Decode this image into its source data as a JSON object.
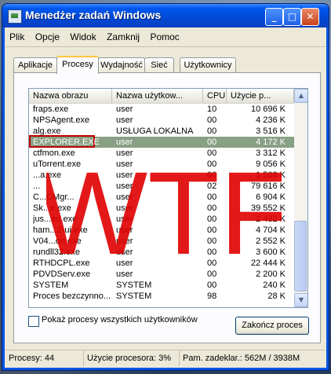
{
  "window": {
    "title": "Menedżer zadań Windows",
    "controls": {
      "minimize": "_",
      "maximize": "□",
      "close": "✕"
    }
  },
  "menu": [
    "Plik",
    "Opcje",
    "Widok",
    "Zamknij",
    "Pomoc"
  ],
  "tabs": [
    {
      "label": "Aplikacje",
      "active": false
    },
    {
      "label": "Procesy",
      "active": true
    },
    {
      "label": "Wydajność",
      "active": false
    },
    {
      "label": "Sieć",
      "active": false
    },
    {
      "label": "Użytkownicy",
      "active": false
    }
  ],
  "processes": {
    "columns": [
      "Nazwa obrazu",
      "Nazwa użytkow...",
      "CPU",
      "Użycie p..."
    ],
    "rows": [
      {
        "name": "fraps.exe",
        "user": "user",
        "cpu": "10",
        "mem": "10 696 K"
      },
      {
        "name": "NPSAgent.exe",
        "user": "user",
        "cpu": "00",
        "mem": "4 236 K"
      },
      {
        "name": "alg.exe",
        "user": "USŁUGA LOKALNA",
        "cpu": "00",
        "mem": "3 516 K"
      },
      {
        "name": "EXPLORER.EXE",
        "user": "user",
        "cpu": "00",
        "mem": "4 172 K",
        "selected": true
      },
      {
        "name": "ctfmon.exe",
        "user": "user",
        "cpu": "00",
        "mem": "3 312 K"
      },
      {
        "name": "uTorrent.exe",
        "user": "user",
        "cpu": "00",
        "mem": "9 056 K"
      },
      {
        "name": "...a.exe",
        "user": "user",
        "cpu": "00",
        "mem": "1 508 K"
      },
      {
        "name": "...",
        "user": "user",
        "cpu": "02",
        "mem": "79 616 K"
      },
      {
        "name": "C...CMgr...",
        "user": "user",
        "cpu": "00",
        "mem": "6 904 K"
      },
      {
        "name": "Sk...e.exe",
        "user": "user",
        "cpu": "00",
        "mem": "39 552 K"
      },
      {
        "name": "jus...ed.exe",
        "user": "user",
        "cpu": "00",
        "mem": "2 432 K"
      },
      {
        "name": "ham...2-ui.exe",
        "user": "user",
        "cpu": "00",
        "mem": "4 704 K"
      },
      {
        "name": "V04...on.exe",
        "user": "user",
        "cpu": "00",
        "mem": "2 552 K"
      },
      {
        "name": "rundll32.exe",
        "user": "user",
        "cpu": "00",
        "mem": "3 600 K"
      },
      {
        "name": "RTHDCPL.exe",
        "user": "user",
        "cpu": "00",
        "mem": "22 444 K"
      },
      {
        "name": "PDVDServ.exe",
        "user": "user",
        "cpu": "00",
        "mem": "2 200 K"
      },
      {
        "name": "SYSTEM",
        "user": "SYSTEM",
        "cpu": "00",
        "mem": "240 K"
      },
      {
        "name": "Proces bezczynno...",
        "user": "SYSTEM",
        "cpu": "98",
        "mem": "28 K"
      }
    ]
  },
  "show_all_checkbox": {
    "label": "Pokaż procesy wszystkich użytkowników",
    "checked": false
  },
  "end_process_button": "Zakończ proces",
  "overlay_text": "WTF",
  "overlay_color": "#e00000",
  "status": {
    "processes": "Procesy: 44",
    "cpu": "Użycie procesora: 3%",
    "memory": "Pam. zadeklar.: 562M / 3938M"
  }
}
